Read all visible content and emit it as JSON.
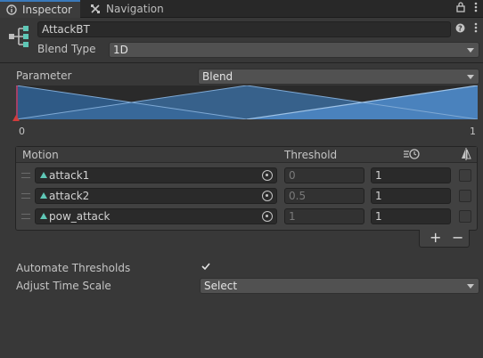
{
  "tabs": {
    "inspector": "Inspector",
    "navigation": "Navigation"
  },
  "header": {
    "name": "AttackBT",
    "blend_type_label": "Blend Type",
    "blend_type_value": "1D"
  },
  "parameter": {
    "label": "Parameter",
    "value": "Blend"
  },
  "graph": {
    "min_label": "0",
    "max_label": "1"
  },
  "motion_table": {
    "headers": {
      "motion": "Motion",
      "threshold": "Threshold"
    },
    "rows": [
      {
        "motion": "attack1",
        "threshold": "0",
        "speed": "1"
      },
      {
        "motion": "attack2",
        "threshold": "0.5",
        "speed": "1"
      },
      {
        "motion": "pow_attack",
        "threshold": "1",
        "speed": "1"
      }
    ]
  },
  "list_buttons": {
    "add": "+",
    "remove": "−"
  },
  "automate_thresholds": {
    "label": "Automate Thresholds",
    "checked": true
  },
  "adjust_time_scale": {
    "label": "Adjust Time Scale",
    "value": "Select"
  },
  "colors": {
    "background": "#383838",
    "accent": "#3a79bb",
    "field": "#2a2a2a"
  }
}
